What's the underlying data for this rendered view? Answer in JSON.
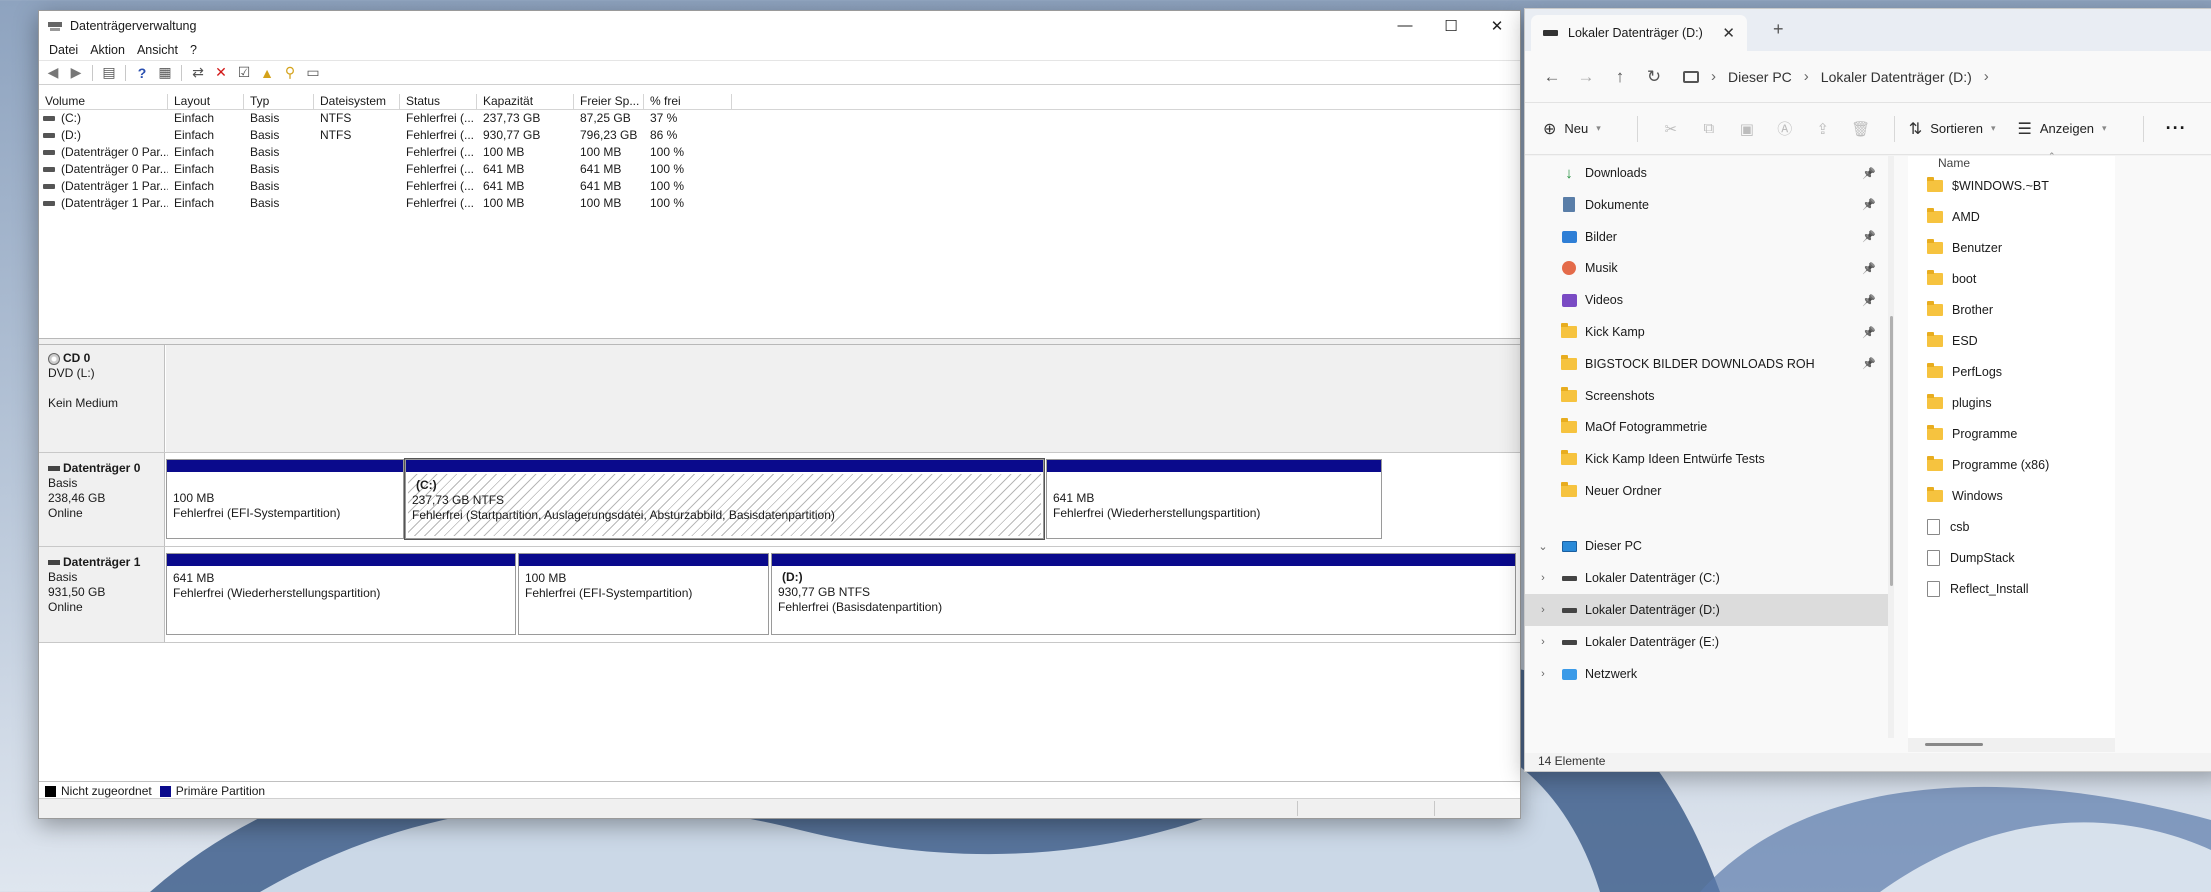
{
  "disk_management": {
    "title": "Datenträgerverwaltung",
    "window_controls": {
      "minimize": "—",
      "maximize": "☐",
      "close": "✕"
    },
    "menu": [
      "Datei",
      "Aktion",
      "Ansicht",
      "?"
    ],
    "volume_table": {
      "columns": [
        "Volume",
        "Layout",
        "Typ",
        "Dateisystem",
        "Status",
        "Kapazität",
        "Freier Sp...",
        "% frei"
      ],
      "rows": [
        [
          "(C:)",
          "Einfach",
          "Basis",
          "NTFS",
          "Fehlerfrei (...",
          "237,73 GB",
          "87,25 GB",
          "37 %"
        ],
        [
          "(D:)",
          "Einfach",
          "Basis",
          "NTFS",
          "Fehlerfrei (...",
          "930,77 GB",
          "796,23 GB",
          "86 %"
        ],
        [
          "(Datenträger 0 Par...",
          "Einfach",
          "Basis",
          "",
          "Fehlerfrei (...",
          "100 MB",
          "100 MB",
          "100 %"
        ],
        [
          "(Datenträger 0 Par...",
          "Einfach",
          "Basis",
          "",
          "Fehlerfrei (...",
          "641 MB",
          "641 MB",
          "100 %"
        ],
        [
          "(Datenträger 1 Par...",
          "Einfach",
          "Basis",
          "",
          "Fehlerfrei (...",
          "641 MB",
          "641 MB",
          "100 %"
        ],
        [
          "(Datenträger 1 Par...",
          "Einfach",
          "Basis",
          "",
          "Fehlerfrei (...",
          "100 MB",
          "100 MB",
          "100 %"
        ]
      ]
    },
    "cd0": {
      "name": "CD 0",
      "line1": "DVD (L:)",
      "line2": "Kein Medium"
    },
    "disk0": {
      "name": "Datenträger 0",
      "type": "Basis",
      "size": "238,46 GB",
      "state": "Online",
      "partitions": [
        {
          "label": "",
          "size": "100 MB",
          "desc": "Fehlerfrei (EFI-Systempartition)"
        },
        {
          "label": "(C:)",
          "size": "237,73 GB NTFS",
          "desc": "Fehlerfrei (Startpartition, Auslagerungsdatei, Absturzabbild, Basisdatenpartition)"
        },
        {
          "label": "",
          "size": "641 MB",
          "desc": "Fehlerfrei (Wiederherstellungspartition)"
        }
      ]
    },
    "disk1": {
      "name": "Datenträger 1",
      "type": "Basis",
      "size": "931,50 GB",
      "state": "Online",
      "partitions": [
        {
          "label": "",
          "size": "641 MB",
          "desc": "Fehlerfrei (Wiederherstellungspartition)"
        },
        {
          "label": "",
          "size": "100 MB",
          "desc": "Fehlerfrei (EFI-Systempartition)"
        },
        {
          "label": "(D:)",
          "size": "930,77 GB NTFS",
          "desc": "Fehlerfrei (Basisdatenpartition)"
        }
      ]
    },
    "legend": [
      {
        "label": "Nicht zugeordnet",
        "color": "#000000"
      },
      {
        "label": "Primäre Partition",
        "color": "#0a0a8c"
      }
    ]
  },
  "explorer": {
    "tab_title": "Lokaler Datenträger (D:)",
    "new_tab": "+",
    "breadcrumb": [
      "Dieser PC",
      "Lokaler Datenträger (D:)"
    ],
    "commands": {
      "new": "Neu",
      "sort": "Sortieren",
      "view": "Anzeigen",
      "more": "···"
    },
    "quick_access": [
      {
        "label": "Downloads",
        "icon": "download-icon",
        "pinned": true
      },
      {
        "label": "Dokumente",
        "icon": "documents-icon",
        "pinned": true
      },
      {
        "label": "Bilder",
        "icon": "pictures-icon",
        "pinned": true
      },
      {
        "label": "Musik",
        "icon": "music-icon",
        "pinned": true
      },
      {
        "label": "Videos",
        "icon": "videos-icon",
        "pinned": true
      },
      {
        "label": "Kick Kamp",
        "icon": "folder-icon",
        "pinned": true
      },
      {
        "label": "BIGSTOCK BILDER DOWNLOADS ROH",
        "icon": "folder-icon",
        "pinned": true
      },
      {
        "label": "Screenshots",
        "icon": "folder-icon",
        "pinned": false
      },
      {
        "label": "MaOf Fotogrammetrie",
        "icon": "folder-icon",
        "pinned": false
      },
      {
        "label": "Kick Kamp Ideen Entwürfe Tests",
        "icon": "folder-icon",
        "pinned": false
      },
      {
        "label": "Neuer Ordner",
        "icon": "folder-icon",
        "pinned": false
      }
    ],
    "this_pc": "Dieser PC",
    "drives": [
      "Lokaler Datenträger (C:)",
      "Lokaler Datenträger (D:)",
      "Lokaler Datenträger (E:)"
    ],
    "network": "Netzwerk",
    "file_column": "Name",
    "files": [
      {
        "name": "$WINDOWS.~BT",
        "kind": "folder"
      },
      {
        "name": "AMD",
        "kind": "folder"
      },
      {
        "name": "Benutzer",
        "kind": "folder"
      },
      {
        "name": "boot",
        "kind": "folder"
      },
      {
        "name": "Brother",
        "kind": "folder"
      },
      {
        "name": "ESD",
        "kind": "folder"
      },
      {
        "name": "PerfLogs",
        "kind": "folder"
      },
      {
        "name": "plugins",
        "kind": "folder"
      },
      {
        "name": "Programme",
        "kind": "folder"
      },
      {
        "name": "Programme (x86)",
        "kind": "folder"
      },
      {
        "name": "Windows",
        "kind": "folder"
      },
      {
        "name": "csb",
        "kind": "file"
      },
      {
        "name": "DumpStack",
        "kind": "file"
      },
      {
        "name": "Reflect_Install",
        "kind": "file"
      }
    ],
    "status": "14 Elemente"
  }
}
